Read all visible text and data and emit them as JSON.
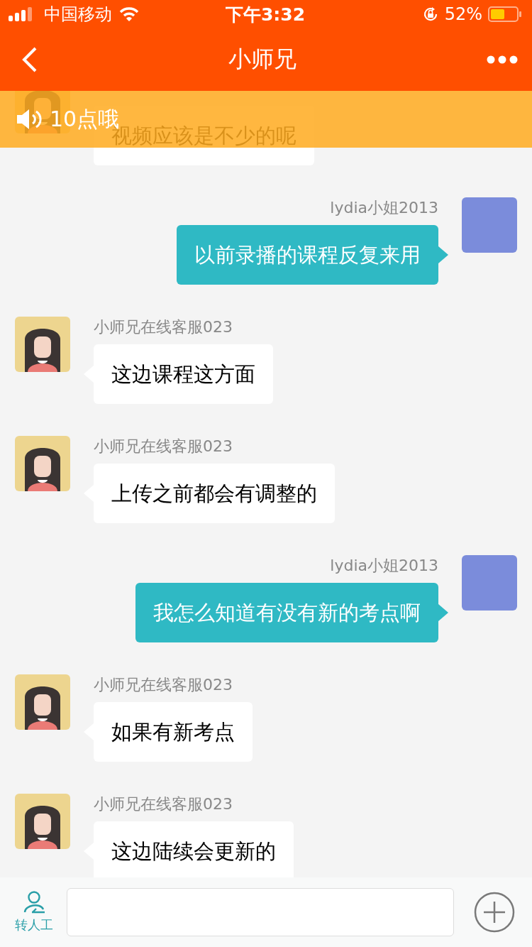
{
  "status_bar": {
    "carrier": "中国移动",
    "time": "下午3:32",
    "battery_percent": "52%"
  },
  "nav_bar": {
    "title": "小师兄"
  },
  "notice_banner": {
    "text": "10点哦"
  },
  "messages": [
    {
      "kind": "incoming",
      "text": "视频应该是不少的呢"
    },
    {
      "kind": "outgoing",
      "sender": "lydia小姐2013",
      "text": "以前录播的课程反复来用"
    },
    {
      "kind": "incoming",
      "sender": "小师兄在线客服023",
      "text": "这边课程这方面"
    },
    {
      "kind": "incoming",
      "sender": "小师兄在线客服023",
      "text": "上传之前都会有调整的"
    },
    {
      "kind": "outgoing",
      "sender": "lydia小姐2013",
      "text": "我怎么知道有没有新的考点啊"
    },
    {
      "kind": "incoming",
      "sender": "小师兄在线客服023",
      "text": "如果有新考点"
    },
    {
      "kind": "incoming",
      "sender": "小师兄在线客服023",
      "text": "这边陆续会更新的"
    }
  ],
  "input_bar": {
    "transfer_label": "转人工"
  }
}
